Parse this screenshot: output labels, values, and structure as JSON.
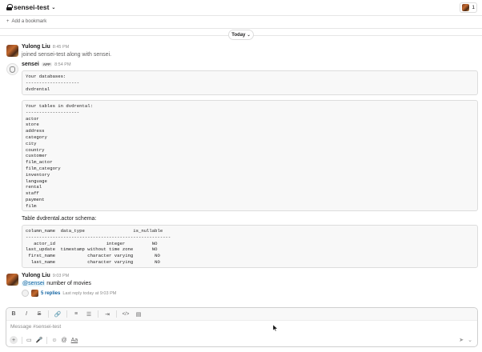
{
  "header": {
    "channel_name": "sensei-test",
    "member_count": "1",
    "add_bookmark": "Add a bookmark"
  },
  "date_divider": "Today",
  "messages": [
    {
      "author": "Yulong Liu",
      "time": "8:45 PM",
      "text": "joined sensei-test along with sensei."
    },
    {
      "author": "sensei",
      "badge": "APP",
      "time": "8:54 PM",
      "blocks": [
        "Your databases:\n--------------------\ndvdrental",
        "Your tables in dvdrental:\n--------------------\nactor\nstore\naddress\ncategory\ncity\ncountry\ncustomer\nfilm_actor\nfilm_category\ninventory\nlanguage\nrental\nstaff\npayment\nfilm"
      ],
      "schema_label": "Table dvdrental.actor schema:",
      "schema_block": "column_name  data_type                  is_nullable\n------------------------------------------------------\n   actor_id                   integer          NO\nlast_update  timestamp without time zone       NO\n first_name            character varying        NO\n  last_name            character varying        NO"
    },
    {
      "author": "Yulong Liu",
      "time": "9:03 PM",
      "mention": "@sensei",
      "text": " number of movies",
      "replies": "5 replies",
      "last_reply": "Last reply today at 9:03 PM"
    }
  ],
  "composer": {
    "placeholder": "Message #sensei-test",
    "format_buttons": [
      "B",
      "I",
      "S",
      "🔗",
      "≡",
      "☰",
      "⇥",
      "</>",
      "▤"
    ],
    "bottom_tools": [
      "+",
      "▭",
      "🎤",
      "☺",
      "@",
      "Aa"
    ],
    "send": "➤",
    "send_options": "⌄"
  },
  "colors": {
    "link": "#1264a3",
    "mention_bg": "#e8f5fa",
    "muted": "#8b8b8b"
  }
}
